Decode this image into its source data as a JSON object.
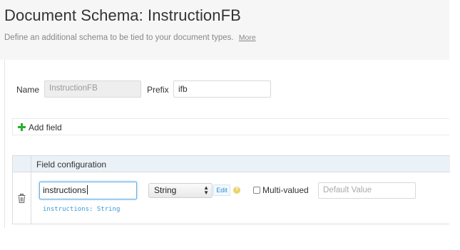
{
  "header": {
    "title": "Document Schema: InstructionFB",
    "subtitle": "Define an additional schema to be tied to your document types.",
    "more_link": "More"
  },
  "form": {
    "name_label": "Name",
    "name_value": "InstructionFB",
    "prefix_label": "Prefix",
    "prefix_value": "ifb"
  },
  "add_field": {
    "label": "Add field",
    "icon": "plus-icon"
  },
  "fields_table": {
    "header": "Field configuration",
    "rows": [
      {
        "name_value": "instructions",
        "type_value": "String",
        "edit_label": "Edit",
        "help_glyph": "?",
        "multivalued_label": "Multi-valued",
        "multivalued_checked": false,
        "default_placeholder": "Default Value",
        "summary": "instructions: String"
      }
    ]
  },
  "colors": {
    "accent_blue": "#3a9bd5",
    "add_green": "#2bb02b",
    "table_header_bg": "#eaf1f7",
    "focus_border": "#66afe9"
  }
}
